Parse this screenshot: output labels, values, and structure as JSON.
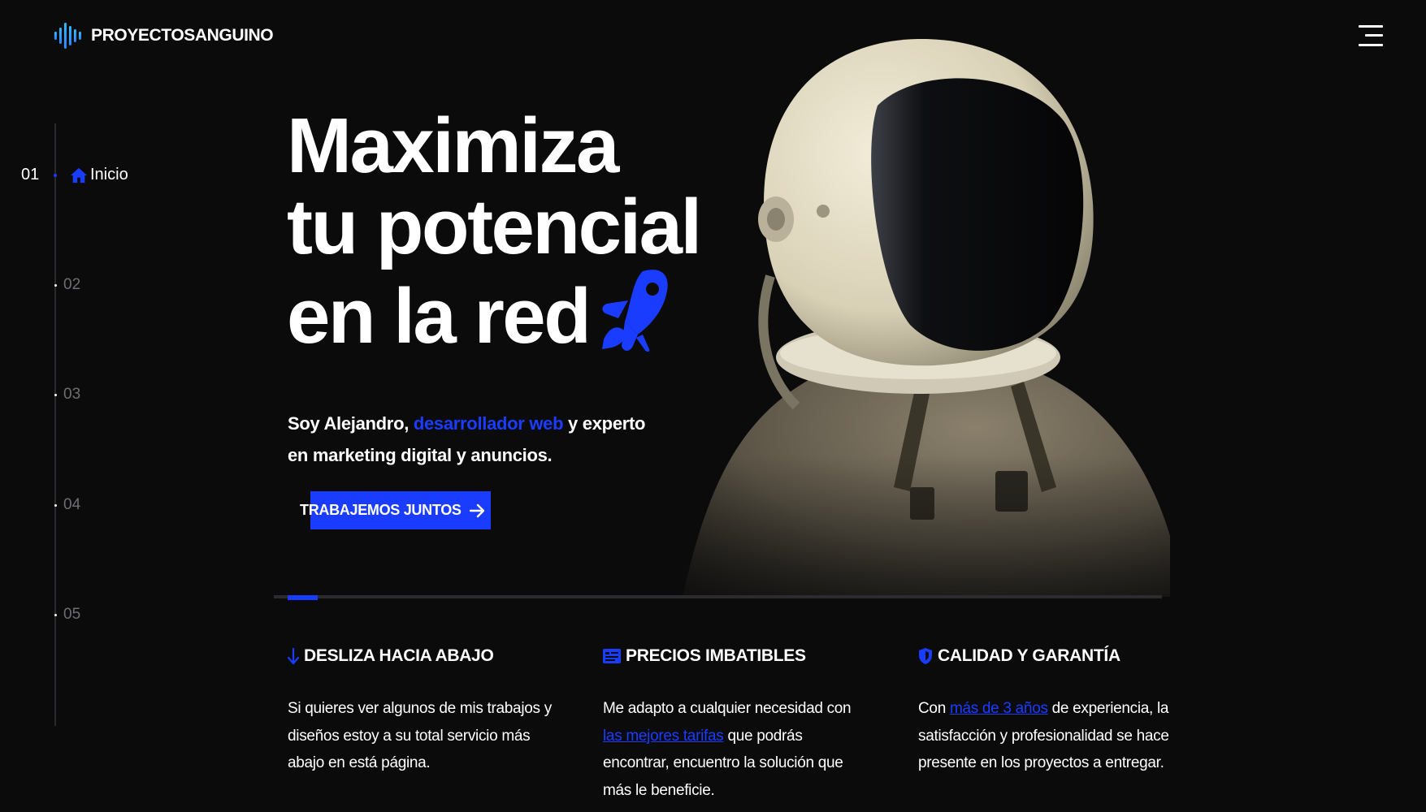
{
  "brand": {
    "name": "PROYECTOSANGUINO",
    "accent_color": "#1a3cff",
    "logo_icon": "sound-wave-icon"
  },
  "header": {
    "menu_icon": "hamburger-menu-icon"
  },
  "side_nav": {
    "active": {
      "number": "01",
      "label": "Inicio",
      "icon": "home-icon"
    },
    "items": [
      "02",
      "03",
      "04",
      "05"
    ]
  },
  "hero": {
    "title_line1": "Maximiza",
    "title_line2": "tu potencial",
    "title_line3": "en la red",
    "title_icon": "rocket-icon",
    "intro_before": "Soy Alejandro, ",
    "intro_highlight": "desarrollador web",
    "intro_after": " y experto en marketing digital y anuncios.",
    "cta_label": "TRABAJEMOS JUNTOS",
    "cta_icon": "arrow-right-icon"
  },
  "features": [
    {
      "icon": "arrow-down-icon",
      "title": "DESLIZA HACIA ABAJO",
      "text": "Si quieres ver algunos de mis trabajos y diseños estoy a su total servicio más abajo en está página."
    },
    {
      "icon": "price-card-icon",
      "title": "PRECIOS IMBATIBLES",
      "text_before": "Me adapto a cualquier necesidad con ",
      "link": "las mejores tarifas",
      "text_after": " que podrás encontrar, encuentro la solución que más le beneficie."
    },
    {
      "icon": "shield-icon",
      "title": "CALIDAD Y GARANTÍA",
      "text_before": "Con ",
      "link": "más de 3 años",
      "text_after": " de experiencia, la satisfacción y profesionalidad se hace presente en los proyectos a entregar."
    }
  ]
}
